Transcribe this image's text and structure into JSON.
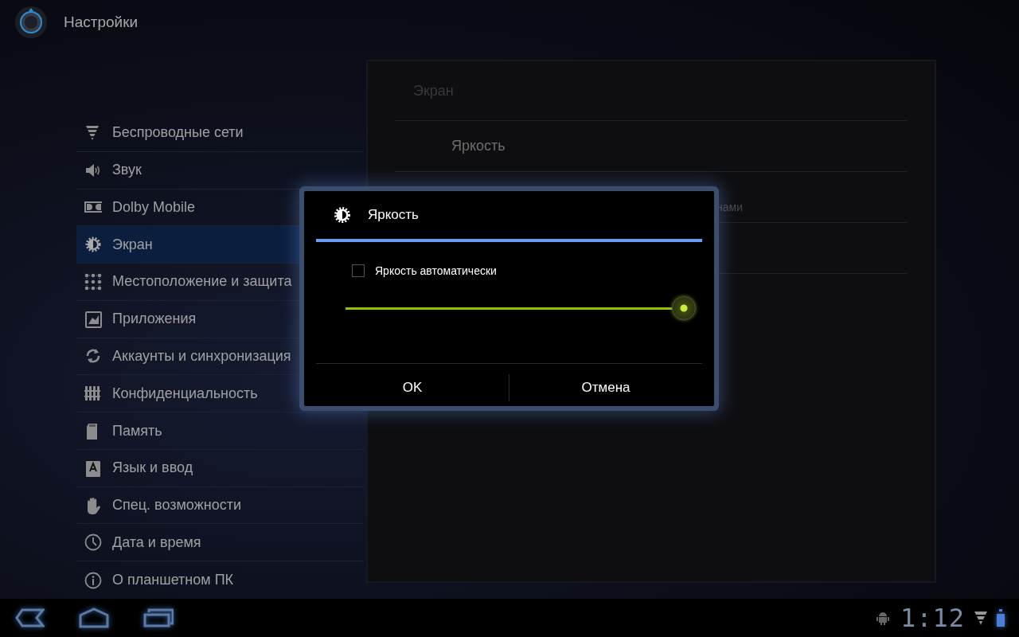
{
  "app_bar": {
    "title": "Настройки"
  },
  "sidebar": {
    "items": [
      {
        "label": "Беспроводные сети",
        "selected": false
      },
      {
        "label": "Звук",
        "selected": false
      },
      {
        "label": "Dolby Mobile",
        "selected": false
      },
      {
        "label": "Экран",
        "selected": true
      },
      {
        "label": "Местоположение и защита",
        "selected": false
      },
      {
        "label": "Приложения",
        "selected": false
      },
      {
        "label": "Аккаунты и синхронизация",
        "selected": false
      },
      {
        "label": "Конфиденциальность",
        "selected": false
      },
      {
        "label": "Память",
        "selected": false
      },
      {
        "label": "Язык и ввод",
        "selected": false
      },
      {
        "label": "Спец. возможности",
        "selected": false
      },
      {
        "label": "Дата и время",
        "selected": false
      },
      {
        "label": "О планшетном ПК",
        "selected": false
      }
    ]
  },
  "detail": {
    "header": "Экран",
    "rows": [
      {
        "title": "Яркость"
      },
      {
        "summary": "нами"
      }
    ]
  },
  "dialog": {
    "title": "Яркость",
    "checkbox": {
      "label": "Яркость автоматически",
      "checked": false
    },
    "slider": {
      "level": 1.0
    },
    "buttons": [
      "OK",
      "Отмена"
    ]
  },
  "status_bar": {
    "time": "1:12"
  }
}
